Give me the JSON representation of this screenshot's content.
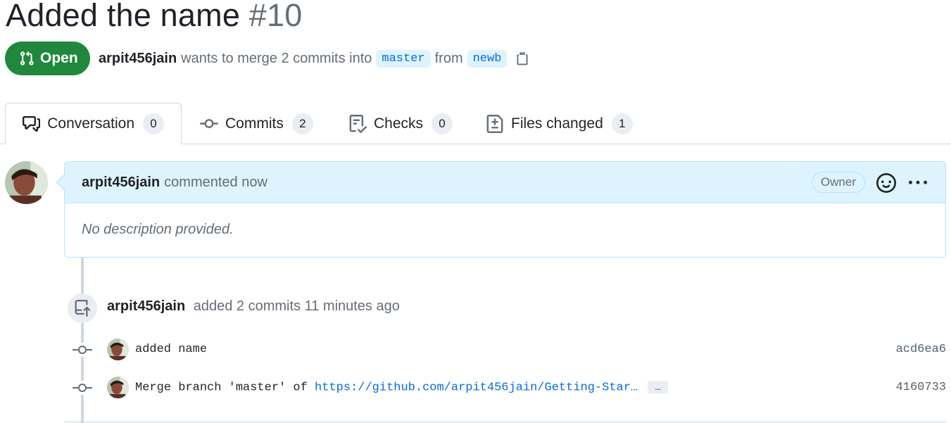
{
  "pr": {
    "title": "Added the name",
    "number": "#10",
    "state": "Open",
    "author": "arpit456jain",
    "merge_text_1": "wants to merge 2 commits into",
    "base_branch": "master",
    "merge_text_2": "from",
    "head_branch": "newb"
  },
  "tabs": [
    {
      "label": "Conversation",
      "count": "0",
      "icon": "comment-discussion-icon"
    },
    {
      "label": "Commits",
      "count": "2",
      "icon": "git-commit-icon"
    },
    {
      "label": "Checks",
      "count": "0",
      "icon": "checklist-icon"
    },
    {
      "label": "Files changed",
      "count": "1",
      "icon": "file-diff-icon"
    }
  ],
  "comment": {
    "author": "arpit456jain",
    "action": "commented now",
    "role": "Owner",
    "body": "No description provided."
  },
  "event": {
    "author": "arpit456jain",
    "text": "added 2 commits 11 minutes ago"
  },
  "commits": [
    {
      "message": "added name",
      "sha": "acd6ea6"
    },
    {
      "message_prefix": "Merge branch 'master' of ",
      "link": "https://github.com/arpit456jain/Getting-Star…",
      "ellipsis": "…",
      "sha": "4160733"
    }
  ],
  "colors": {
    "open_green": "#1f883d",
    "accent_blue": "#0969da",
    "comment_header_bg": "#ddf4ff",
    "border": "#d0d7de"
  }
}
